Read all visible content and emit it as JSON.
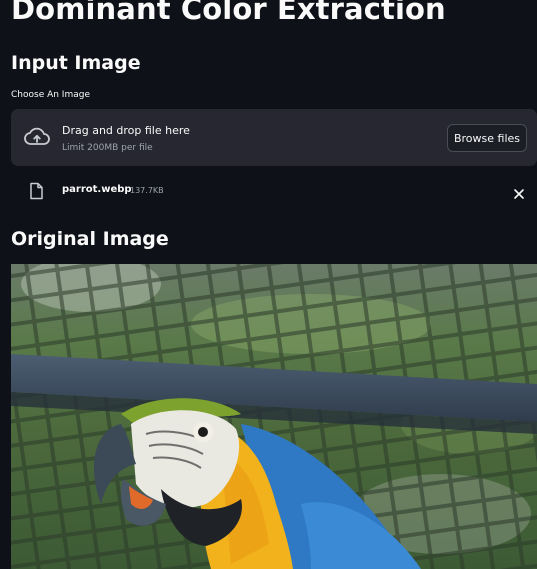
{
  "app": {
    "title": "Dominant Color Extraction"
  },
  "input_section": {
    "heading": "Input Image",
    "uploader_label": "Choose An Image",
    "dropzone": {
      "title": "Drag and drop file here",
      "limit": "Limit 200MB per file",
      "browse_label": "Browse files",
      "icon": "cloud-upload-icon"
    },
    "file": {
      "name": "parrot.webp",
      "size": "137.7KB",
      "icon": "file-icon",
      "remove_icon": "close-icon"
    }
  },
  "original_section": {
    "heading": "Original Image"
  },
  "colors": {
    "background": "#0e1117",
    "surface": "#262730",
    "text": "#fafafa",
    "muted": "#9ea3ad"
  }
}
